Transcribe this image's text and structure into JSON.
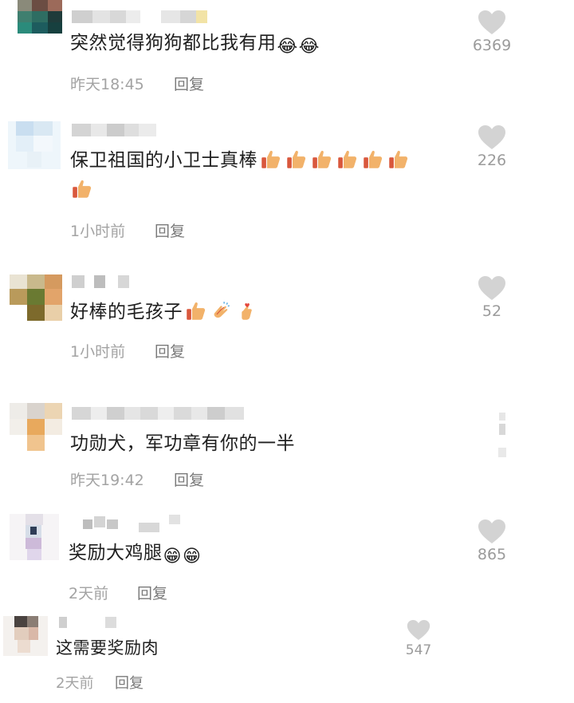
{
  "colors": {
    "text": "#1f1f1f",
    "meta": "#a3a3a3",
    "reply": "#7a7a7a",
    "heart": "#d3d3d3",
    "count": "#9b9b9b"
  },
  "comments": [
    {
      "text": "突然觉得狗狗都比我有用",
      "emojis": [
        "😂",
        "😂"
      ],
      "time": "昨天18:45",
      "reply": "回复",
      "likes": "6369"
    },
    {
      "text": "保卫祖国的小卫士真棒",
      "emojis": [
        "thumbs-up",
        "thumbs-up",
        "thumbs-up",
        "thumbs-up",
        "thumbs-up",
        "thumbs-up",
        "thumbs-up"
      ],
      "time": "1小时前",
      "reply": "回复",
      "likes": "226"
    },
    {
      "text": "好棒的毛孩子",
      "emojis": [
        "thumbs-up",
        "clapping-hands",
        "finger-heart"
      ],
      "time": "1小时前",
      "reply": "回复",
      "likes": "52"
    },
    {
      "text": "功勋犬，军功章有你的一半",
      "emojis": [],
      "time": "昨天19:42",
      "reply": "回复",
      "likes": ""
    },
    {
      "text": "奖励大鸡腿",
      "emojis": [
        "😁",
        "😁"
      ],
      "time": "2天前",
      "reply": "回复",
      "likes": "865"
    },
    {
      "text": "这需要奖励肉",
      "emojis": [],
      "time": "2天前",
      "reply": "回复",
      "likes": "547"
    }
  ]
}
